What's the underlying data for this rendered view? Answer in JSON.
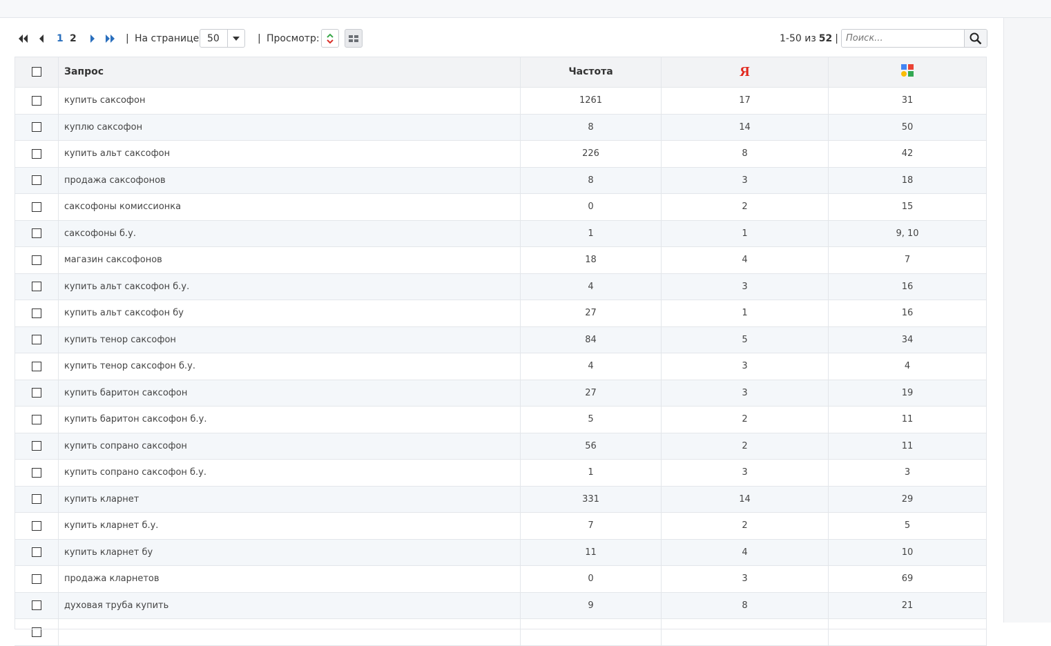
{
  "pagination": {
    "pages": [
      "1",
      "2"
    ],
    "current_page": "1",
    "separator": "|",
    "per_page_label": "На странице:",
    "per_page_value": "50",
    "view_label": "Просмотр:"
  },
  "counter": {
    "range": "1-50 из",
    "total": "52",
    "separator": "|"
  },
  "search": {
    "placeholder": "Поиск..."
  },
  "table": {
    "headers": {
      "query": "Запрос",
      "frequency": "Частота",
      "yandex": "Я",
      "google_icon": "google-logo-icon"
    },
    "rows": [
      {
        "query": "купить саксофон",
        "frequency": "1261",
        "yandex": "17",
        "google": "31"
      },
      {
        "query": "куплю саксофон",
        "frequency": "8",
        "yandex": "14",
        "google": "50"
      },
      {
        "query": "купить альт саксофон",
        "frequency": "226",
        "yandex": "8",
        "google": "42"
      },
      {
        "query": "продажа саксофонов",
        "frequency": "8",
        "yandex": "3",
        "google": "18"
      },
      {
        "query": "саксофоны комиссионка",
        "frequency": "0",
        "yandex": "2",
        "google": "15"
      },
      {
        "query": "саксофоны б.у.",
        "frequency": "1",
        "yandex": "1",
        "google": "9, 10"
      },
      {
        "query": "магазин саксофонов",
        "frequency": "18",
        "yandex": "4",
        "google": "7"
      },
      {
        "query": "купить альт саксофон б.у.",
        "frequency": "4",
        "yandex": "3",
        "google": "16"
      },
      {
        "query": "купить альт саксофон бу",
        "frequency": "27",
        "yandex": "1",
        "google": "16"
      },
      {
        "query": "купить тенор саксофон",
        "frequency": "84",
        "yandex": "5",
        "google": "34"
      },
      {
        "query": "купить тенор саксофон б.у.",
        "frequency": "4",
        "yandex": "3",
        "google": "4"
      },
      {
        "query": "купить баритон саксофон",
        "frequency": "27",
        "yandex": "3",
        "google": "19"
      },
      {
        "query": "купить баритон саксофон б.у.",
        "frequency": "5",
        "yandex": "2",
        "google": "11"
      },
      {
        "query": "купить сопрано саксофон",
        "frequency": "56",
        "yandex": "2",
        "google": "11"
      },
      {
        "query": "купить сопрано саксофон б.у.",
        "frequency": "1",
        "yandex": "3",
        "google": "3"
      },
      {
        "query": "купить кларнет",
        "frequency": "331",
        "yandex": "14",
        "google": "29"
      },
      {
        "query": "купить кларнет б.у.",
        "frequency": "7",
        "yandex": "2",
        "google": "5"
      },
      {
        "query": "купить кларнет бу",
        "frequency": "11",
        "yandex": "4",
        "google": "10"
      },
      {
        "query": "продажа кларнетов",
        "frequency": "0",
        "yandex": "3",
        "google": "69"
      },
      {
        "query": "духовая труба купить",
        "frequency": "9",
        "yandex": "8",
        "google": "21"
      },
      {
        "query": "",
        "frequency": "",
        "yandex": "",
        "google": ""
      }
    ]
  },
  "colors": {
    "accent": "#2a6fbd",
    "yandex_red": "#e1261c",
    "row_alt": "#f4f7fa",
    "header_bg": "#f2f3f5"
  }
}
